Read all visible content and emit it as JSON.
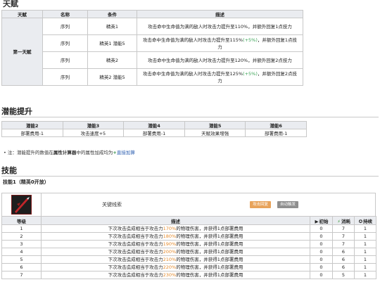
{
  "talent_section": {
    "title": "天赋",
    "headers": [
      "天赋",
      "名称",
      "条件",
      "描述"
    ],
    "talent_name": "第一天赋",
    "rows": [
      {
        "name": "序列",
        "cond": "精英1",
        "desc_a": "攻击命中生命值为满的敌人时攻击力提升至110%，并额外回复1点技力",
        "desc_b": "",
        "desc_c": ""
      },
      {
        "name": "序列",
        "cond": "精英1 潜能5",
        "desc_a": "攻击命中生命值为满的敌人时攻击力提升至115%",
        "desc_b": "(+5%)",
        "desc_c": "，并额外回复1点技力"
      },
      {
        "name": "序列",
        "cond": "精英2",
        "desc_a": "攻击命中生命值为满的敌人时攻击力提升至120%，并额外回复2点技力",
        "desc_b": "",
        "desc_c": ""
      },
      {
        "name": "序列",
        "cond": "精英2 潜能5",
        "desc_a": "攻击命中生命值为满的敌人时攻击力提升至125%",
        "desc_b": "(+5%)",
        "desc_c": "，并额外回复2点技力"
      }
    ]
  },
  "potential_section": {
    "title": "潜能提升",
    "headers": [
      "潜能2",
      "潜能3",
      "潜能4",
      "潜能5",
      "潜能6"
    ],
    "values": [
      "部署费用-1",
      "攻击速度+5",
      "部署费用-1",
      "天赋效果增强",
      "部署费用-1"
    ],
    "note_prefix": "注：潜能提升的数值在",
    "note_bold": "属性计算器",
    "note_mid": "中的属性加成均为",
    "note_plus": "+",
    "note_link": "直接加算"
  },
  "skill_section": {
    "title": "技能",
    "skill_label": "技能1（精英0开放）",
    "skill_icon": "blade-skill-icon",
    "skill_name": "关键线索",
    "badge_sp": "攻击回复",
    "badge_trigger": "自动触发",
    "headers": {
      "level": "等级",
      "desc": "描述",
      "initial": "初始",
      "cost": "消耗",
      "duration": "持续"
    },
    "header_icons": {
      "initial": "▶",
      "cost": "⚡",
      "duration": "✪"
    },
    "levels": [
      {
        "level": "1",
        "pct": "170%",
        "initial": "0",
        "cost": "7",
        "duration": "1"
      },
      {
        "level": "2",
        "pct": "180%",
        "initial": "0",
        "cost": "7",
        "duration": "1"
      },
      {
        "level": "3",
        "pct": "190%",
        "initial": "0",
        "cost": "7",
        "duration": "1"
      },
      {
        "level": "4",
        "pct": "200%",
        "initial": "0",
        "cost": "6",
        "duration": "1"
      },
      {
        "level": "5",
        "pct": "210%",
        "initial": "0",
        "cost": "6",
        "duration": "1"
      },
      {
        "level": "6",
        "pct": "220%",
        "initial": "0",
        "cost": "6",
        "duration": "1"
      },
      {
        "level": "7",
        "pct": "230%",
        "initial": "0",
        "cost": "5",
        "duration": "1"
      }
    ],
    "desc_prefix": "下次攻击造成相当于攻击力",
    "desc_suffix": "的物理伤害，并获得1点部署费用"
  },
  "colors": {
    "header_bg": "#eaecf0",
    "border": "#c8c8c8",
    "green": "#3aa356",
    "orange": "#e58b2c",
    "badge_sp": "#e8a35a",
    "badge_auto": "#8f8f8f"
  }
}
